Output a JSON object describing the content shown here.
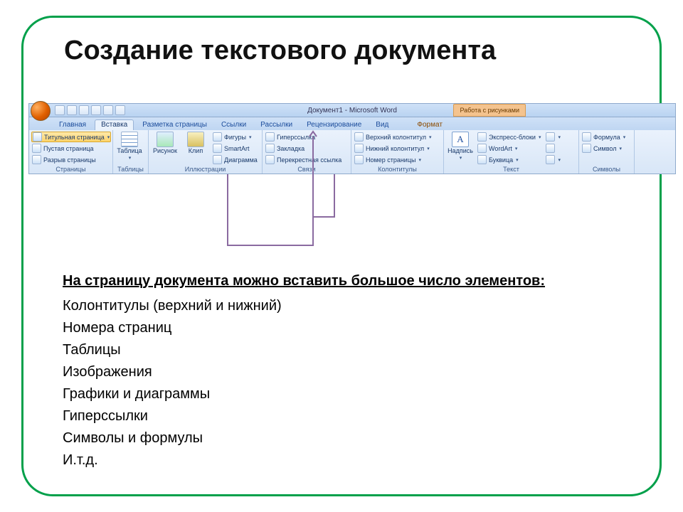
{
  "slide": {
    "title": "Создание текстового документа"
  },
  "word": {
    "doc_title": "Документ1 - Microsoft Word",
    "context_tab": "Работа с рисунками",
    "tabs": {
      "home": "Главная",
      "insert": "Вставка",
      "layout": "Разметка страницы",
      "references": "Ссылки",
      "mailings": "Рассылки",
      "review": "Рецензирование",
      "view": "Вид",
      "format": "Формат"
    },
    "groups": {
      "pages": {
        "label": "Страницы",
        "cover": "Титульная страница",
        "blank": "Пустая страница",
        "break": "Разрыв страницы"
      },
      "tables": {
        "label": "Таблицы",
        "table": "Таблица"
      },
      "illustrations": {
        "label": "Иллюстрации",
        "picture": "Рисунок",
        "clip": "Клип",
        "shapes": "Фигуры",
        "smartart": "SmartArt",
        "chart": "Диаграмма"
      },
      "links": {
        "label": "Связи",
        "hyperlink": "Гиперссылка",
        "bookmark": "Закладка",
        "crossref": "Перекрестная ссылка"
      },
      "hf": {
        "label": "Колонтитулы",
        "header": "Верхний колонтитул",
        "footer": "Нижний колонтитул",
        "pagen": "Номер страницы"
      },
      "text": {
        "label": "Текст",
        "textbox": "Надпись",
        "quick": "Экспресс-блоки",
        "wordart": "WordArt",
        "dropcap": "Буквица"
      },
      "symbols": {
        "label": "Символы",
        "equation": "Формула",
        "symbol": "Символ"
      }
    }
  },
  "body": {
    "intro": "На страницу документа можно вставить большое число элементов:",
    "items": [
      "Колонтитулы (верхний и нижний)",
      "Номера страниц",
      "Таблицы",
      "Изображения",
      "Графики и диаграммы",
      "Гиперссылки",
      "Символы и формулы",
      "И.т.д."
    ]
  }
}
